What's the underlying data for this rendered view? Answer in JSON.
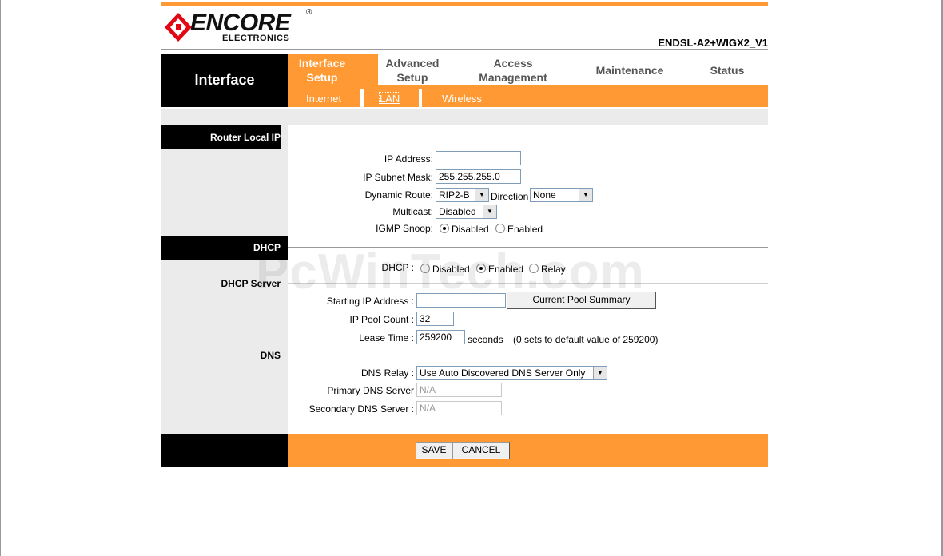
{
  "header": {
    "logo_main": "ENCORE",
    "logo_sub": "ELECTRONICS",
    "logo_reg": "®",
    "model": "ENDSL-A2+WIGX2_V1"
  },
  "nav": {
    "section_title": "Interface",
    "items": [
      {
        "line1": "Interface",
        "line2": "Setup"
      },
      {
        "line1": "Advanced",
        "line2": "Setup"
      },
      {
        "line1": "Access",
        "line2": "Management"
      },
      {
        "line1": "Maintenance",
        "line2": ""
      },
      {
        "line1": "Status",
        "line2": ""
      }
    ],
    "subtabs": [
      "Internet",
      "LAN",
      "Wireless"
    ]
  },
  "router_local_ip": {
    "title": "Router Local IP",
    "ip_address_label": "IP Address:",
    "ip_address_value": "",
    "subnet_label": "IP Subnet Mask:",
    "subnet_value": "255.255.255.0",
    "dynamic_route_label": "Dynamic Route:",
    "dynamic_route_value": "RIP2-B",
    "direction_label": "Direction",
    "direction_value": "None",
    "multicast_label": "Multicast:",
    "multicast_value": "Disabled",
    "igmp_label": "IGMP Snoop:",
    "igmp_disabled": "Disabled",
    "igmp_enabled": "Enabled"
  },
  "dhcp": {
    "title": "DHCP",
    "dhcp_label": "DHCP :",
    "opt_disabled": "Disabled",
    "opt_enabled": "Enabled",
    "opt_relay": "Relay",
    "server_title": "DHCP Server",
    "start_ip_label": "Starting IP Address :",
    "start_ip_value": "",
    "pool_summary_button": "Current Pool Summary",
    "pool_count_label": "IP Pool Count :",
    "pool_count_value": "32",
    "lease_label": "Lease Time :",
    "lease_value": "259200",
    "lease_unit": "seconds",
    "lease_note": "(0 sets to default value of 259200)"
  },
  "dns": {
    "title": "DNS",
    "relay_label": "DNS Relay :",
    "relay_value": "Use Auto Discovered DNS Server Only",
    "primary_label": "Primary DNS Server",
    "primary_value": "N/A",
    "secondary_label": "Secondary DNS Server :",
    "secondary_value": "N/A"
  },
  "footer": {
    "save": "SAVE",
    "cancel": "CANCEL"
  },
  "watermark": "PcWinTech.com",
  "colors": {
    "accent": "#ff9933",
    "bar": "#000000",
    "panel": "#ebebeb"
  }
}
